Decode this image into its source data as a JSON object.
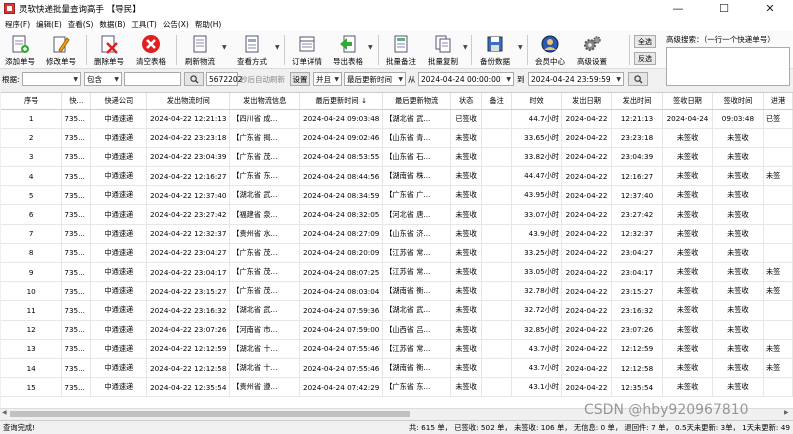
{
  "window": {
    "title": "灵软快递批量查询高手 【导民】"
  },
  "menu": [
    "程序(F)",
    "编辑(E)",
    "查看(S)",
    "数据(B)",
    "工具(T)",
    "公告(X)",
    "帮助(H)"
  ],
  "toolbar": {
    "add": "添加单号",
    "edit": "修改单号",
    "delete": "删除单号",
    "clear": "清空表格",
    "refresh": "刷新物流",
    "view": "查看方式",
    "order": "订单详情",
    "export": "导出表格",
    "batch_note": "批量备注",
    "batch_copy": "批量复制",
    "backup": "备份数据",
    "member": "会员中心",
    "settings": "高级设置",
    "select_all": "全选",
    "invert": "反选"
  },
  "advanced_search": {
    "label": "高级搜索：（一行一个快递单号）"
  },
  "filter": {
    "label": "根据:",
    "field": "",
    "mode": "包含",
    "keyword": "",
    "seconds": "5672202",
    "auto_refresh": "秒后自动刷新",
    "set": "设置",
    "logic": "并且",
    "date_field": "最后更新时间",
    "from": "从",
    "date_from": "2024-04-24 00:00:00",
    "to": "到",
    "date_to": "2024-04-24 23:59:59"
  },
  "columns": [
    "序号",
    "快...",
    "快递公司",
    "发出物流时间",
    "发出物流信息",
    "最后更新时间 ↓",
    "最后更新物流",
    "状态",
    "备注",
    "时效",
    "发出日期",
    "发出时间",
    "签收日期",
    "签收时间",
    "进港"
  ],
  "rows": [
    [
      "1",
      "735...",
      "中通速递",
      "2024-04-22 12:21:13",
      "【四川省 成...",
      "2024-04-24 09:03:48",
      "【湖北省 武...",
      "已签收",
      "",
      "44.7小时",
      "2024-04-22",
      "12:21:13",
      "2024-04-24",
      "09:03:48",
      "已签"
    ],
    [
      "2",
      "735...",
      "中通速递",
      "2024-04-22 23:23:18",
      "【广东省 揭...",
      "2024-04-24 09:02:46",
      "【山东省 青...",
      "未签收",
      "",
      "33.65小时",
      "2024-04-22",
      "23:23:18",
      "未签收",
      "未签收",
      ""
    ],
    [
      "3",
      "735...",
      "中通速递",
      "2024-04-22 23:04:39",
      "【广东省 茂...",
      "2024-04-24 08:53:55",
      "【山东省 石...",
      "未签收",
      "",
      "33.82小时",
      "2024-04-22",
      "23:04:39",
      "未签收",
      "未签收",
      ""
    ],
    [
      "4",
      "735...",
      "中通速递",
      "2024-04-22 12:16:27",
      "【广东省 东...",
      "2024-04-24 08:44:56",
      "【湖南省 株...",
      "未签收",
      "",
      "44.47小时",
      "2024-04-22",
      "12:16:27",
      "未签收",
      "未签收",
      "未签"
    ],
    [
      "5",
      "735...",
      "中通速递",
      "2024-04-22 12:37:40",
      "【湖北省 武...",
      "2024-04-24 08:34:59",
      "【广东省 广...",
      "未签收",
      "",
      "43.95小时",
      "2024-04-22",
      "12:37:40",
      "未签收",
      "未签收",
      ""
    ],
    [
      "6",
      "735...",
      "中通速递",
      "2024-04-22 23:27:42",
      "【福建省 泉...",
      "2024-04-24 08:32:05",
      "【河北省 唐...",
      "未签收",
      "",
      "33.07小时",
      "2024-04-22",
      "23:27:42",
      "未签收",
      "未签收",
      ""
    ],
    [
      "7",
      "735...",
      "中通速递",
      "2024-04-22 12:32:37",
      "【贵州省 水...",
      "2024-04-24 08:27:09",
      "【山东省 济...",
      "未签收",
      "",
      "43.9小时",
      "2024-04-22",
      "12:32:37",
      "未签收",
      "未签收",
      ""
    ],
    [
      "8",
      "735...",
      "中通速递",
      "2024-04-22 23:04:27",
      "【广东省 茂...",
      "2024-04-24 08:20:09",
      "【江苏省 常...",
      "未签收",
      "",
      "33.25小时",
      "2024-04-22",
      "23:04:27",
      "未签收",
      "未签收",
      ""
    ],
    [
      "9",
      "735...",
      "中通速递",
      "2024-04-22 23:04:17",
      "【广东省 茂...",
      "2024-04-24 08:07:25",
      "【江苏省 常...",
      "未签收",
      "",
      "33.05小时",
      "2024-04-22",
      "23:04:17",
      "未签收",
      "未签收",
      "未签"
    ],
    [
      "10",
      "735...",
      "中通速递",
      "2024-04-22 23:15:27",
      "【广东省 茂...",
      "2024-04-24 08:03:04",
      "【湖南省 衡...",
      "未签收",
      "",
      "32.78小时",
      "2024-04-22",
      "23:15:27",
      "未签收",
      "未签收",
      "未签"
    ],
    [
      "11",
      "735...",
      "中通速递",
      "2024-04-22 23:16:32",
      "【湖北省 武...",
      "2024-04-24 07:59:36",
      "【湖北省 武...",
      "未签收",
      "",
      "32.72小时",
      "2024-04-22",
      "23:16:32",
      "未签收",
      "未签收",
      ""
    ],
    [
      "12",
      "735...",
      "中通速递",
      "2024-04-22 23:07:26",
      "【河南省 市...",
      "2024-04-24 07:59:00",
      "【山西省 吕...",
      "未签收",
      "",
      "32.85小时",
      "2024-04-22",
      "23:07:26",
      "未签收",
      "未签收",
      ""
    ],
    [
      "13",
      "735...",
      "中通速递",
      "2024-04-22 12:12:59",
      "【湖北省 十...",
      "2024-04-24 07:55:46",
      "【江苏省 常...",
      "未签收",
      "",
      "43.7小时",
      "2024-04-22",
      "12:12:59",
      "未签收",
      "未签收",
      "未签"
    ],
    [
      "14",
      "735...",
      "中通速递",
      "2024-04-22 12:12:58",
      "【湖北省 十...",
      "2024-04-24 07:55:46",
      "【湖南省 衡...",
      "未签收",
      "",
      "43.7小时",
      "2024-04-22",
      "12:12:58",
      "未签收",
      "未签收",
      "未签"
    ],
    [
      "15",
      "735...",
      "中通速递",
      "2024-04-22 12:35:54",
      "【贵州省 遵...",
      "2024-04-24 07:42:29",
      "【广东省 东...",
      "未签收",
      "",
      "43.1小时",
      "2024-04-22",
      "12:35:54",
      "未签收",
      "未签收",
      ""
    ]
  ],
  "status": {
    "left": "查询完成!",
    "right": "共: 615 单， 已签收:  502 单， 未签收:  106 单， 无信息: 0 单， 退回件: 7 单， 0.5天未更新: 3单， 1天未更新: 49"
  },
  "watermark": "CSDN @hby920967810"
}
